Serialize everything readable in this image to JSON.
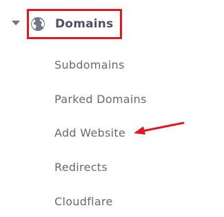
{
  "nav": {
    "section": {
      "label": "Domains",
      "icon": "globe-icon",
      "expanded": true
    },
    "items": [
      {
        "label": "Subdomains"
      },
      {
        "label": "Parked Domains"
      },
      {
        "label": "Add Website"
      },
      {
        "label": "Redirects"
      },
      {
        "label": "Cloudflare"
      }
    ]
  },
  "annotations": {
    "highlight_color": "#e8131b",
    "arrow_target": "Add Website"
  },
  "colors": {
    "title": "#4c5163",
    "item": "#64687a",
    "icon": "#737888"
  }
}
